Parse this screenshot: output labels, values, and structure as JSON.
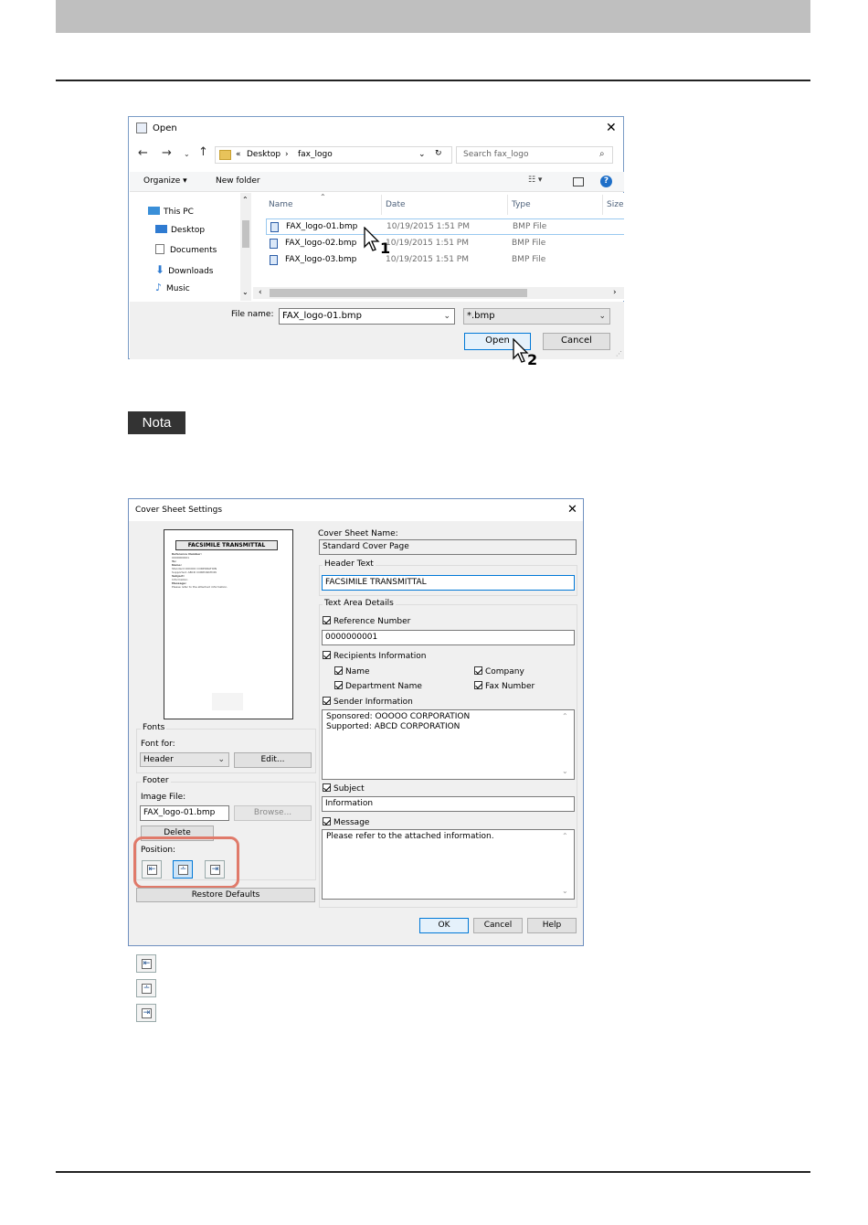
{
  "open_dialog": {
    "title": "Open",
    "close": "✕",
    "path": [
      "«",
      "Desktop",
      "›",
      "fax_logo"
    ],
    "search_placeholder": "Search fax_logo",
    "organize": "Organize ▾",
    "new_folder": "New folder",
    "nav_items": [
      "This PC",
      "Desktop",
      "Documents",
      "Downloads",
      "Music"
    ],
    "columns": [
      "Name",
      "Date",
      "Type",
      "Size"
    ],
    "files": [
      {
        "name": "FAX_logo-01.bmp",
        "date": "10/19/2015 1:51 PM",
        "type": "BMP File"
      },
      {
        "name": "FAX_logo-02.bmp",
        "date": "10/19/2015 1:51 PM",
        "type": "BMP File"
      },
      {
        "name": "FAX_logo-03.bmp",
        "date": "10/19/2015 1:51 PM",
        "type": "BMP File"
      }
    ],
    "file_name_label": "File name:",
    "file_name_value": "FAX_logo-01.bmp",
    "filter_value": "*.bmp",
    "open_button": "Open",
    "cancel_button": "Cancel",
    "step1": "1",
    "step2": "2"
  },
  "note_label": "Nota",
  "cover_dialog": {
    "title": "Cover Sheet Settings",
    "close": "✕",
    "preview": {
      "header": "FACSIMILE TRANSMITTAL",
      "lines": [
        "Reference Number:",
        "0000000001",
        "To:",
        "Name:",
        "Standard OOOOO CORPORATION",
        "Supported: ABCD CORPORATION",
        "Subject:",
        "Information",
        "Message:",
        "Please refer to the attached information."
      ]
    },
    "fonts_group": "Fonts",
    "font_for_label": "Font for:",
    "font_for_value": "Header",
    "edit_button": "Edit...",
    "footer_group": "Footer",
    "image_file_label": "Image File:",
    "image_file_value": "FAX_logo-01.bmp",
    "browse_button": "Browse...",
    "delete_button": "Delete",
    "position_label": "Position:",
    "restore_button": "Restore Defaults",
    "cover_sheet_name_label": "Cover Sheet Name:",
    "cover_sheet_name_value": "Standard Cover Page",
    "header_text_label": "Header Text",
    "header_text_value": "FACSIMILE TRANSMITTAL",
    "text_area_details": "Text Area Details",
    "reference_number_label": "Reference Number",
    "reference_number_value": "0000000001",
    "recipients_label": "Recipients Information",
    "name_label": "Name",
    "company_label": "Company",
    "department_label": "Department Name",
    "fax_number_label": "Fax Number",
    "sender_label": "Sender Information",
    "sender_line1": "Sponsored: OOOOO CORPORATION",
    "sender_line2": "Supported: ABCD CORPORATION",
    "subject_label": "Subject",
    "subject_value": "Information",
    "message_label": "Message",
    "message_value": "Please refer to the attached information.",
    "ok_button": "OK",
    "cancel_button": "Cancel",
    "help_button": "Help"
  },
  "colors": {
    "highlight": "#e07a6a",
    "accent": "#0078d7"
  }
}
